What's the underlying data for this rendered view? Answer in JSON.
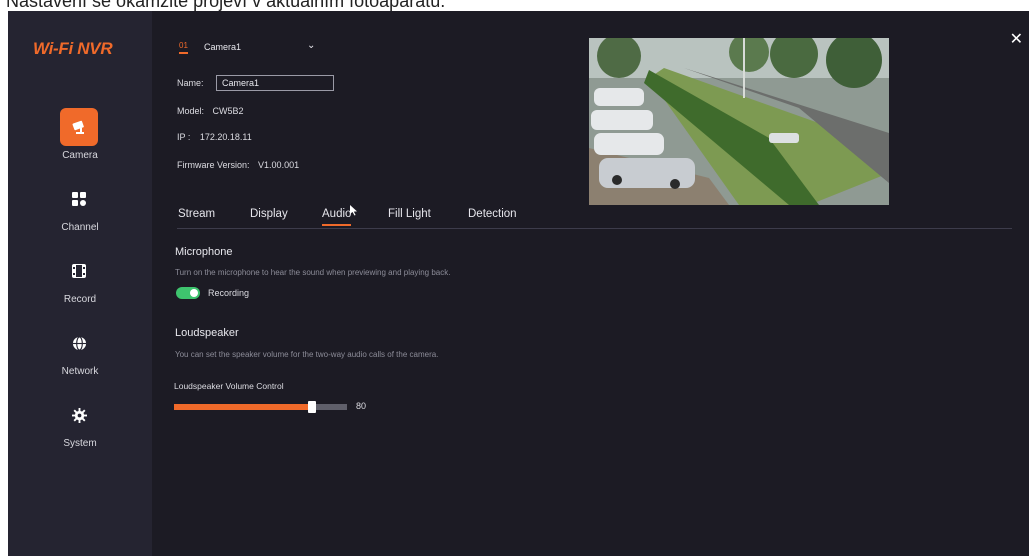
{
  "caption": "Nastavení se okamžitě projeví v aktuálním fotoaparátu.",
  "app": {
    "logo": "Wi-Fi NVR"
  },
  "sidebar": {
    "items": [
      {
        "label": "Camera",
        "icon": "camera-icon",
        "active": true
      },
      {
        "label": "Channel",
        "icon": "grid-icon",
        "active": false
      },
      {
        "label": "Record",
        "icon": "film-icon",
        "active": false
      },
      {
        "label": "Network",
        "icon": "globe-icon",
        "active": false
      },
      {
        "label": "System",
        "icon": "gear-icon",
        "active": false
      }
    ]
  },
  "camera_select": {
    "number": "01",
    "name": "Camera1"
  },
  "info": {
    "name_label": "Name:",
    "name_value": "Camera1",
    "model_label": "Model:",
    "model_value": "CW5B2",
    "ip_label": "IP :",
    "ip_value": "172.20.18.11",
    "firmware_label": "Firmware Version:",
    "firmware_value": "V1.00.001"
  },
  "tabs": [
    {
      "label": "Stream",
      "active": false
    },
    {
      "label": "Display",
      "active": false
    },
    {
      "label": "Audio",
      "active": true
    },
    {
      "label": "Fill Light",
      "active": false
    },
    {
      "label": "Detection",
      "active": false
    }
  ],
  "microphone": {
    "title": "Microphone",
    "description": "Turn on the microphone to hear the sound when previewing and playing back.",
    "toggle_label": "Recording",
    "toggle_on": true
  },
  "loudspeaker": {
    "title": "Loudspeaker",
    "description": "You can set the speaker volume for the two-way audio calls of the camera.",
    "volume_label": "Loudspeaker Volume Control",
    "volume": 80,
    "volume_text": "80"
  },
  "colors": {
    "accent": "#f06a2a",
    "toggle_on": "#3ec46e",
    "background": "#1c1b24",
    "sidebar": "#252431"
  }
}
